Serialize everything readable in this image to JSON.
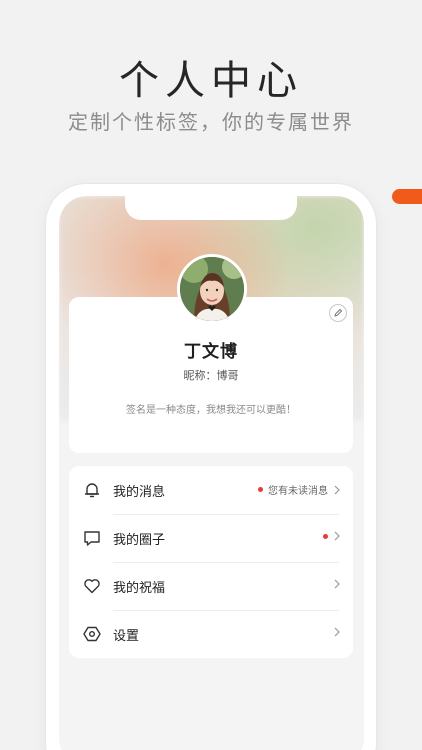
{
  "hero": {
    "title": "个人中心",
    "subtitle": "定制个性标签，你的专属世界"
  },
  "profile": {
    "name": "丁文博",
    "nickname": "昵称：博哥",
    "signature": "签名是一种态度，我想我还可以更酷！"
  },
  "menu": {
    "items": [
      {
        "label": "我的消息",
        "badge_text": "您有未读消息",
        "has_dot": true,
        "icon": "bell-icon"
      },
      {
        "label": "我的圈子",
        "badge_text": "",
        "has_dot": true,
        "icon": "chat-bubble-icon"
      },
      {
        "label": "我的祝福",
        "badge_text": "",
        "has_dot": false,
        "icon": "heart-icon"
      },
      {
        "label": "设置",
        "badge_text": "",
        "has_dot": false,
        "icon": "settings-hexagon-icon"
      }
    ]
  },
  "colors": {
    "accent": "#f05a1a",
    "dot": "#e83a3a",
    "background": "#f2f2f2"
  }
}
